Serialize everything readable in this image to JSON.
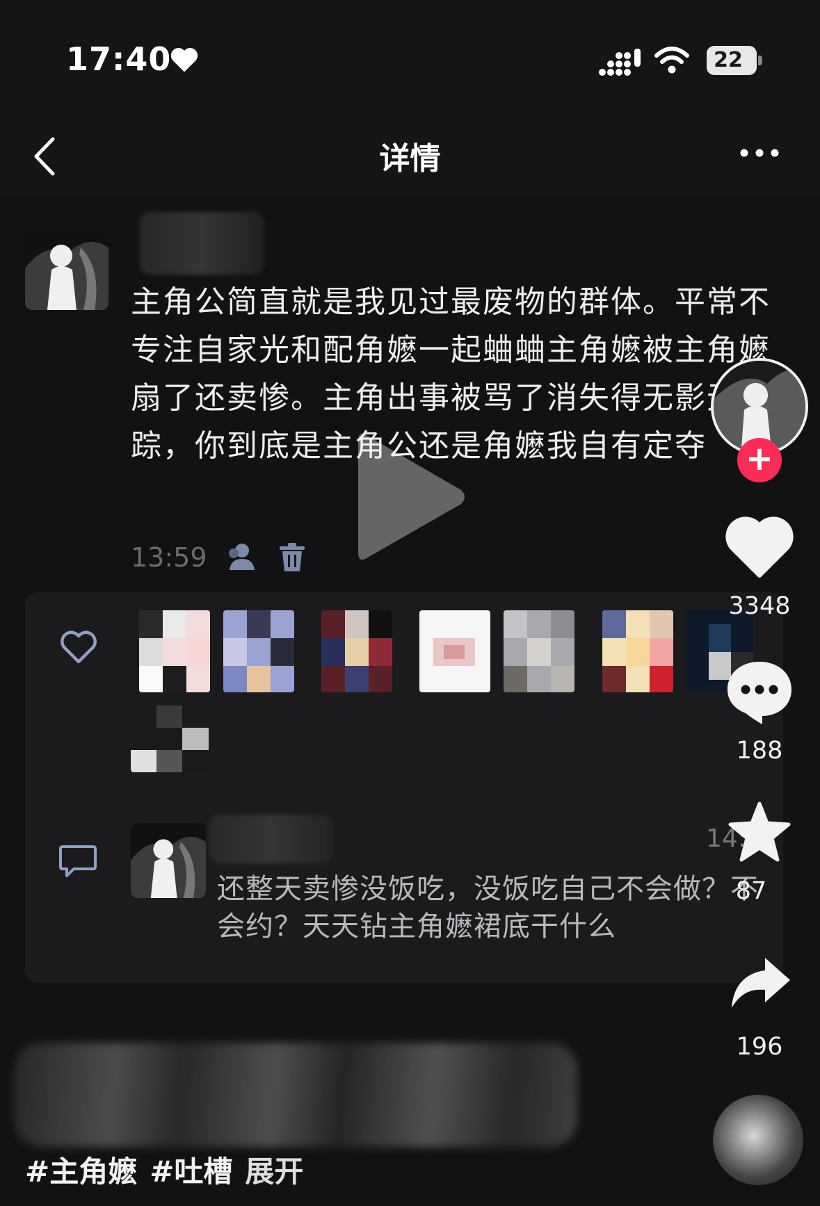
{
  "status_bar": {
    "time": "17:40",
    "battery": "22"
  },
  "nav": {
    "title": "详情"
  },
  "post": {
    "text": "主角公简直就是我见过最废物的群体。平常不专注自家光和配角嬷一起蛐蛐主角嬷被主角嬷扇了还卖惨。主角出事被骂了消失得无影无踪，你到底是主角公还是角嬷我自有定夺",
    "time": "13:59"
  },
  "comment": {
    "time": "14:",
    "text": "还整天卖惨没饭吃，没饭吃自己不会做？不会约？天天钻主角嬷裙底干什么"
  },
  "rail": {
    "likes": "3348",
    "comments": "188",
    "favorites": "87",
    "shares": "196"
  },
  "footer": {
    "tag1": "#主角嬷",
    "tag2": "#吐槽",
    "expand": "展开"
  },
  "colors": {
    "follow": "#fb2c55",
    "background": "#141416"
  }
}
